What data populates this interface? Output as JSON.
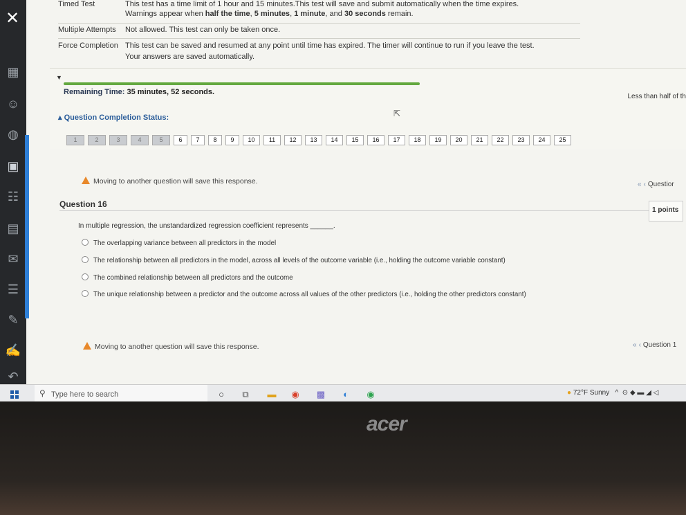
{
  "test_info": {
    "timed_label": "Timed Test",
    "timed_line1": "This test has a time limit of 1 hour and 15 minutes.This test will save and submit automatically when the time expires.",
    "timed_line2_a": "Warnings appear when ",
    "timed_line2_b": "half the time",
    "timed_line2_c": ", ",
    "timed_line2_d": "5 minutes",
    "timed_line2_e": ", ",
    "timed_line2_f": "1 minute",
    "timed_line2_g": ", and ",
    "timed_line2_h": "30 seconds",
    "timed_line2_i": " remain.",
    "multiple_label": "Multiple Attempts",
    "multiple_desc": "Not allowed. This test can only be taken once.",
    "force_label": "Force Completion",
    "force_desc": "This test can be saved and resumed at any point until time has expired. The timer will continue to run if you leave the test.",
    "autosave": "Your answers are saved automatically."
  },
  "status": {
    "remaining_label": "Remaining Time:",
    "remaining_value": "35 minutes, 52 seconds.",
    "less_than": "Less than half of th",
    "completion_label": "Question Completion Status:",
    "progress": 0.55,
    "questions": [
      {
        "n": "1",
        "answered": true
      },
      {
        "n": "2",
        "answered": true
      },
      {
        "n": "3",
        "answered": true
      },
      {
        "n": "4",
        "answered": true
      },
      {
        "n": "5",
        "answered": true
      },
      {
        "n": "6",
        "answered": false
      },
      {
        "n": "7",
        "answered": false
      },
      {
        "n": "8",
        "answered": false
      },
      {
        "n": "9",
        "answered": false
      },
      {
        "n": "10",
        "answered": false
      },
      {
        "n": "11",
        "answered": false
      },
      {
        "n": "12",
        "answered": false
      },
      {
        "n": "13",
        "answered": false
      },
      {
        "n": "14",
        "answered": false
      },
      {
        "n": "15",
        "answered": false
      },
      {
        "n": "16",
        "answered": false
      },
      {
        "n": "17",
        "answered": false
      },
      {
        "n": "18",
        "answered": false
      },
      {
        "n": "19",
        "answered": false
      },
      {
        "n": "20",
        "answered": false
      },
      {
        "n": "21",
        "answered": false
      },
      {
        "n": "22",
        "answered": false
      },
      {
        "n": "23",
        "answered": false
      },
      {
        "n": "24",
        "answered": false
      },
      {
        "n": "25",
        "answered": false
      }
    ]
  },
  "question": {
    "save_warning": "Moving to another question will save this response.",
    "nav_top": "Questior",
    "nav_bottom": "Question 1",
    "title": "Question 16",
    "points": "1 points",
    "text": "In multiple regression, the unstandardized regression coefficient represents ______.",
    "options": [
      "The overlapping variance between all predictors in the model",
      "The relationship between all predictors in the model, across all levels of the outcome variable (i.e., holding the outcome variable constant)",
      "The combined relationship between all predictors and the outcome",
      "The unique relationship between a predictor and the outcome across all values of the other predictors (i.e., holding the other predictors constant)"
    ]
  },
  "taskbar": {
    "search_placeholder": "Type here to search",
    "weather": "72°F  Sunny"
  },
  "brand": "acer",
  "icons": [
    "close-icon",
    "calendar-icon",
    "globe-icon",
    "book-icon",
    "people-icon",
    "grid-icon",
    "mail-icon",
    "list-icon",
    "tools-icon",
    "edit-icon",
    "back-icon",
    "windows-icon",
    "search-icon",
    "cortana-icon",
    "taskview-icon",
    "file-explorer-icon",
    "chrome-icon",
    "teams-icon",
    "edge-icon",
    "chrome-alt-icon"
  ]
}
